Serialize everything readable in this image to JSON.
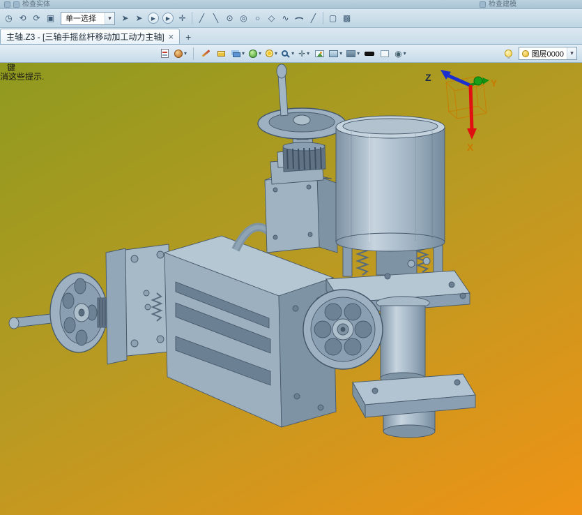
{
  "colors": {
    "viewport_top": "#8f9a1f",
    "viewport_mid": "#b99a22",
    "viewport_bottom": "#ef9315",
    "model_body": "#9db1c2",
    "layer_dot_yellow": "#e8b71e"
  },
  "ribbon": {
    "left_group_label": "检查实体",
    "right_group_label": "检查建模"
  },
  "selection_toolbar": {
    "mode_value": "单一选择"
  },
  "tab_bar": {
    "active_tab_label": "主轴.Z3 - [三轴手摇丝杆移动加工动力主轴]",
    "close_glyph": "×",
    "new_tab_glyph": "+"
  },
  "view_toolbar": {
    "layer_value": "图层0000"
  },
  "viewport": {
    "hint_line1": "键",
    "hint_line2": "消这些提示.",
    "axes": {
      "x": "X",
      "y": "Y",
      "z": "Z"
    }
  },
  "icons": {
    "clock": "◷",
    "undo": "⟲",
    "redo": "⟳",
    "square": "▣",
    "dropdown": "▾",
    "cursor": "➤",
    "play": "▶",
    "move": "✛",
    "line": "╱",
    "line2": "╲",
    "point": "⊙",
    "target": "◎",
    "circle": "○",
    "polygon": "◇",
    "spline": "∿",
    "arc": "(",
    "slash": "╱",
    "ghost1": "▢",
    "ghost2": "▩",
    "eye": "◉",
    "compass": "✛"
  }
}
